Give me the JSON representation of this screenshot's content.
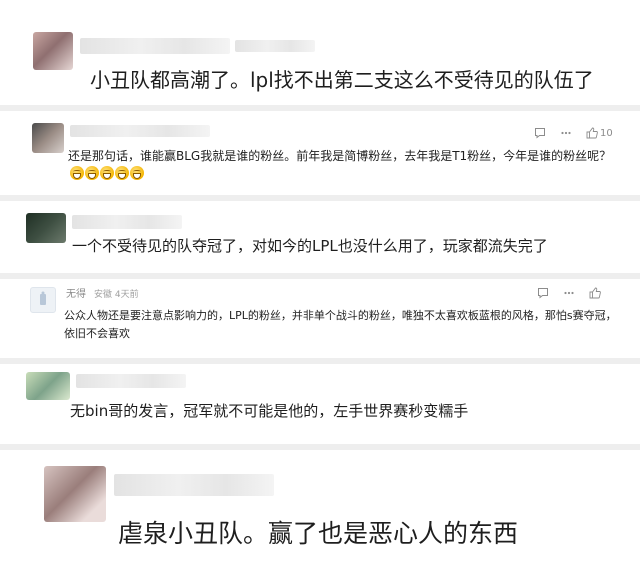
{
  "comments": [
    {
      "text": "小丑队都高潮了。lpl找不出第二支这么不受待见的队伍了"
    },
    {
      "text": "还是那句话，谁能赢BLG我就是谁的粉丝。前年我是简博粉丝，去年我是T1粉丝，今年是谁的粉丝呢？",
      "emoji_count": 5,
      "emoji_icon": "grinning-face-emoji"
    },
    {
      "text": "一个不受待见的队夺冠了，对如今的LPL也没什么用了，玩家都流失完了"
    },
    {
      "username": "无得",
      "meta": "安徽 4天前",
      "text": "公众人物还是要注意点影响力的，LPL的粉丝，并非单个战斗的粉丝，唯独不太喜欢板蓝根的风格，那怕s赛夺冠，依旧不会喜欢"
    },
    {
      "text": "无bin哥的发言，冠军就不可能是他的，左手世界赛秒变糯手"
    },
    {
      "text": "虐泉小丑队。赢了也是恶心人的东西"
    }
  ],
  "actions": {
    "icons": [
      "comment-icon",
      "share-icon",
      "like-icon"
    ],
    "like_count": "10"
  },
  "colors": {
    "divider": "#eeeeee",
    "icon": "#8c8c8c",
    "text": "#1e1e1e",
    "emoji": "#f4b400"
  }
}
